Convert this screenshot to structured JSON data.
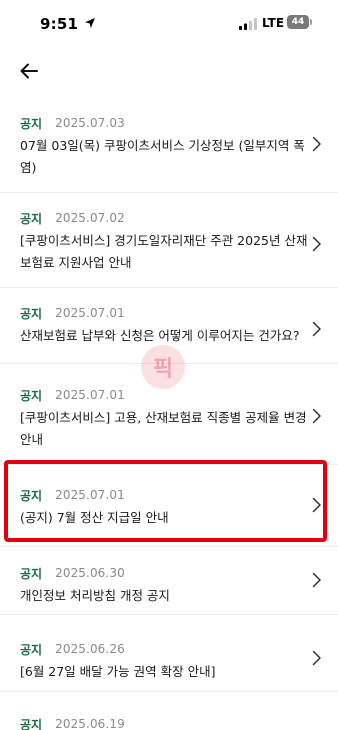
{
  "status_bar": {
    "time": "9:51",
    "network": "LTE",
    "battery": "44"
  },
  "header": {
    "back_icon": "arrow-left-icon"
  },
  "watermark": {
    "text": "픽"
  },
  "notices": [
    {
      "badge": "공지",
      "date": "2025.07.03",
      "title": "07월 03일(목) 쿠팡이츠서비스 기상정보 (일부지역 폭염)"
    },
    {
      "badge": "공지",
      "date": "2025.07.02",
      "title": "[쿠팡이츠서비스] 경기도일자리재단 주관 2025년 산재보험료 지원사업 안내"
    },
    {
      "badge": "공지",
      "date": "2025.07.01",
      "title": "산재보험료 납부와 신청은 어떻게 이루어지는 건가요?"
    },
    {
      "badge": "공지",
      "date": "2025.07.01",
      "title": "[쿠팡이츠서비스] 고용, 산재보험료 직종별 공제율 변경 안내"
    },
    {
      "badge": "공지",
      "date": "2025.07.01",
      "title": "(공지) 7월 정산 지급일 안내"
    },
    {
      "badge": "공지",
      "date": "2025.06.30",
      "title": "개인정보 처리방침 개정 공지"
    },
    {
      "badge": "공지",
      "date": "2025.06.26",
      "title": "[6월 27일 배달 가능 권역 확장 안내]"
    },
    {
      "badge": "공지",
      "date": "2025.06.19",
      "title": ""
    }
  ],
  "highlight_color": "#e2000f",
  "accent_color": "#1d6b46"
}
